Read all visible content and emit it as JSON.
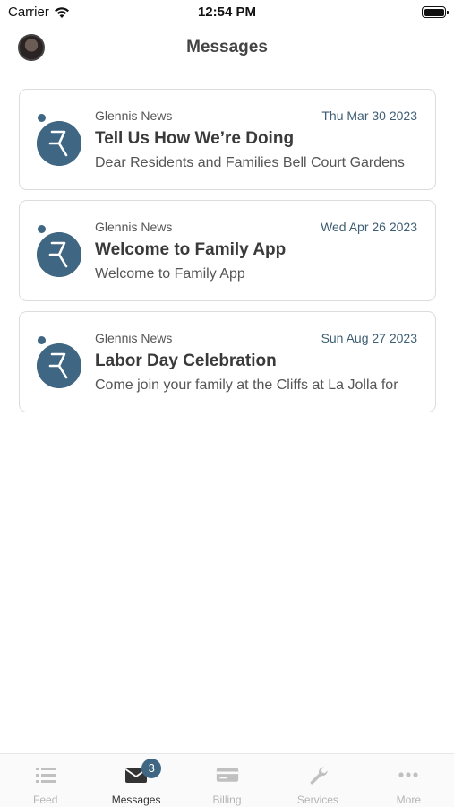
{
  "status_bar": {
    "carrier": "Carrier",
    "time": "12:54 PM"
  },
  "header": {
    "title": "Messages"
  },
  "messages": [
    {
      "sender": "Glennis News",
      "date": "Thu Mar 30 2023",
      "subject": "Tell Us How We’re Doing",
      "preview": "Dear Residents and Families Bell Court Gardens"
    },
    {
      "sender": "Glennis News",
      "date": "Wed Apr 26 2023",
      "subject": "Welcome to Family App",
      "preview": "Welcome to Family App"
    },
    {
      "sender": "Glennis News",
      "date": "Sun Aug 27 2023",
      "subject": "Labor Day Celebration",
      "preview": "Come join your family at the Cliffs at La Jolla for"
    }
  ],
  "tabs": [
    {
      "label": "Feed",
      "icon": "list-icon"
    },
    {
      "label": "Messages",
      "icon": "envelope-icon",
      "badge": "3"
    },
    {
      "label": "Billing",
      "icon": "credit-card-icon"
    },
    {
      "label": "Services",
      "icon": "wrench-icon"
    },
    {
      "label": "More",
      "icon": "more-dots-icon"
    }
  ],
  "colors": {
    "accent": "#3f6682",
    "date_text": "#3d5e74",
    "inactive_tab": "#b5b5b5"
  }
}
